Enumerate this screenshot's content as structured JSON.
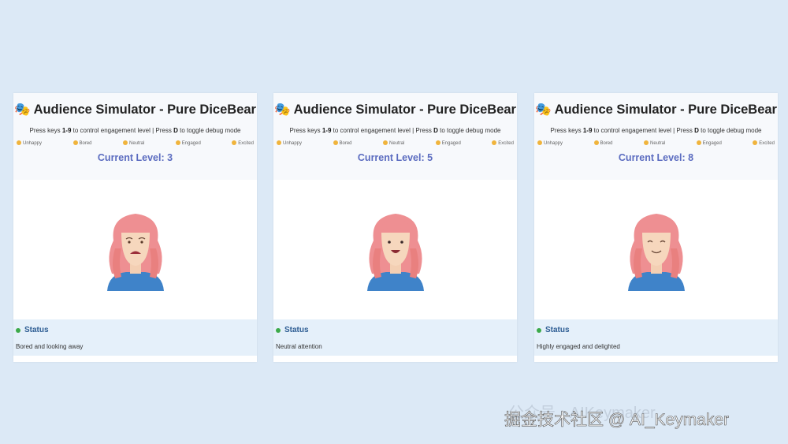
{
  "app": {
    "title": "Audience Simulator - Pure DiceBear",
    "hint_prefix": "Press keys ",
    "hint_keys": "1-9",
    "hint_mid": " to control engagement level | Press ",
    "hint_d": "D",
    "hint_suffix": " to toggle debug mode",
    "legend": [
      "Unhappy",
      "Bored",
      "Neutral",
      "Engaged",
      "Excited"
    ],
    "status_title": "Status"
  },
  "panels": [
    {
      "level": "Current Level: 3",
      "status": "Bored and looking away",
      "mouth": "open-frown"
    },
    {
      "level": "Current Level: 5",
      "status": "Neutral attention",
      "mouth": "open-smile"
    },
    {
      "level": "Current Level: 8",
      "status": "Highly engaged and delighted",
      "mouth": "smile-closed-eyes"
    }
  ],
  "watermark": {
    "main": "掘金技术社区 @ AI_Keymaker",
    "faint": "公众号 · AIKeymaker"
  },
  "colors": {
    "hair": "#ee8f92",
    "shirt": "#3f83c9",
    "level": "#5b6cc0",
    "status_dot": "#3caa4a"
  }
}
